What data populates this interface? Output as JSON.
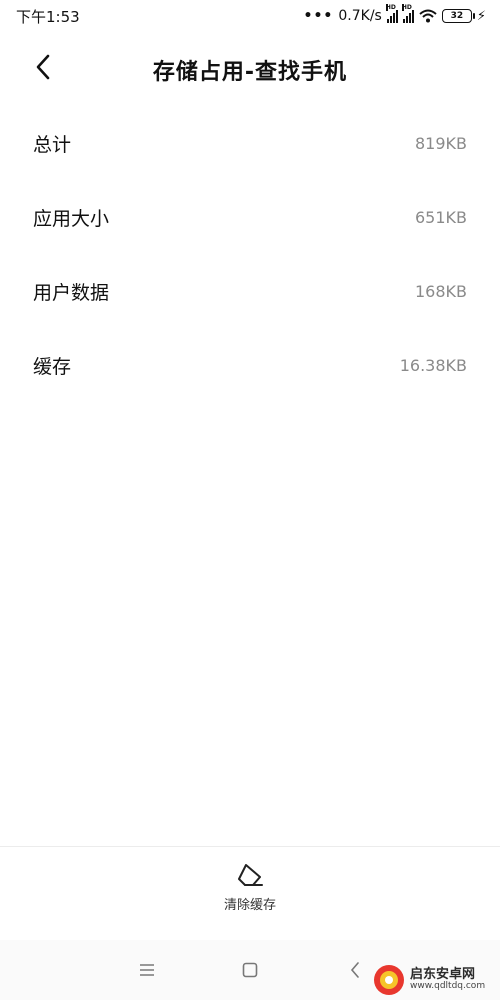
{
  "status_bar": {
    "time": "下午1:53",
    "dots": "•••",
    "speed": "0.7K/s",
    "battery": "32",
    "hd_label": "HD"
  },
  "header": {
    "title": "存储占用-查找手机"
  },
  "storage_rows": [
    {
      "label": "总计",
      "value": "819KB"
    },
    {
      "label": "应用大小",
      "value": "651KB"
    },
    {
      "label": "用户数据",
      "value": "168KB"
    },
    {
      "label": "缓存",
      "value": "16.38KB"
    }
  ],
  "actions": {
    "clear_cache_label": "清除缓存"
  },
  "watermark": {
    "name": "启东安卓网",
    "url": "www.qdltdq.com"
  },
  "colors": {
    "text": "#111111",
    "value": "#8a8a8a",
    "accent_watermark": "#e8372e"
  }
}
